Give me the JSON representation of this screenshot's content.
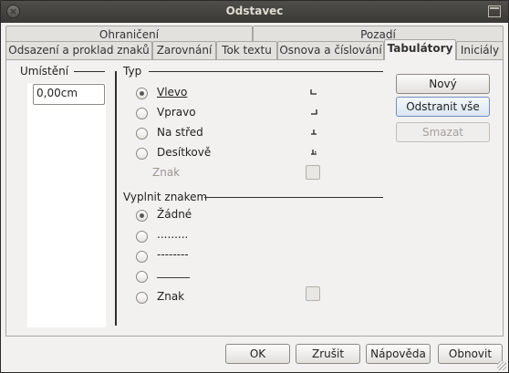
{
  "window": {
    "title": "Odstavec"
  },
  "tabs_row1": [
    {
      "label": "Ohraničení"
    },
    {
      "label": "Pozadí"
    }
  ],
  "tabs_row2": [
    {
      "label": "Odsazení a proklad znaků"
    },
    {
      "label": "Zarovnání"
    },
    {
      "label": "Tok textu"
    },
    {
      "label": "Osnova a číslování"
    },
    {
      "label": "Tabulátory"
    },
    {
      "label": "Iniciály"
    }
  ],
  "position": {
    "heading": "Umístění",
    "value": "0,00cm"
  },
  "type": {
    "heading": "Typ",
    "options": [
      {
        "label": "Vlevo",
        "checked": true
      },
      {
        "label": "Vpravo",
        "checked": false
      },
      {
        "label": "Na střed",
        "checked": false
      },
      {
        "label": "Desítkově",
        "checked": false
      }
    ],
    "char_label": "Znak"
  },
  "fill": {
    "heading": "Vyplnit znakem",
    "options": [
      {
        "label": "Žádné",
        "checked": true
      },
      {
        "label": ".........",
        "checked": false
      },
      {
        "label": "--------",
        "checked": false
      },
      {
        "label": "______",
        "checked": false
      },
      {
        "label": "Znak",
        "checked": false
      }
    ]
  },
  "side_buttons": {
    "new": "Nový",
    "delete_all": "Odstranit vše",
    "delete": "Smazat"
  },
  "bottom_buttons": {
    "ok": "OK",
    "cancel": "Zrušit",
    "help": "Nápověda",
    "reset": "Obnovit"
  }
}
